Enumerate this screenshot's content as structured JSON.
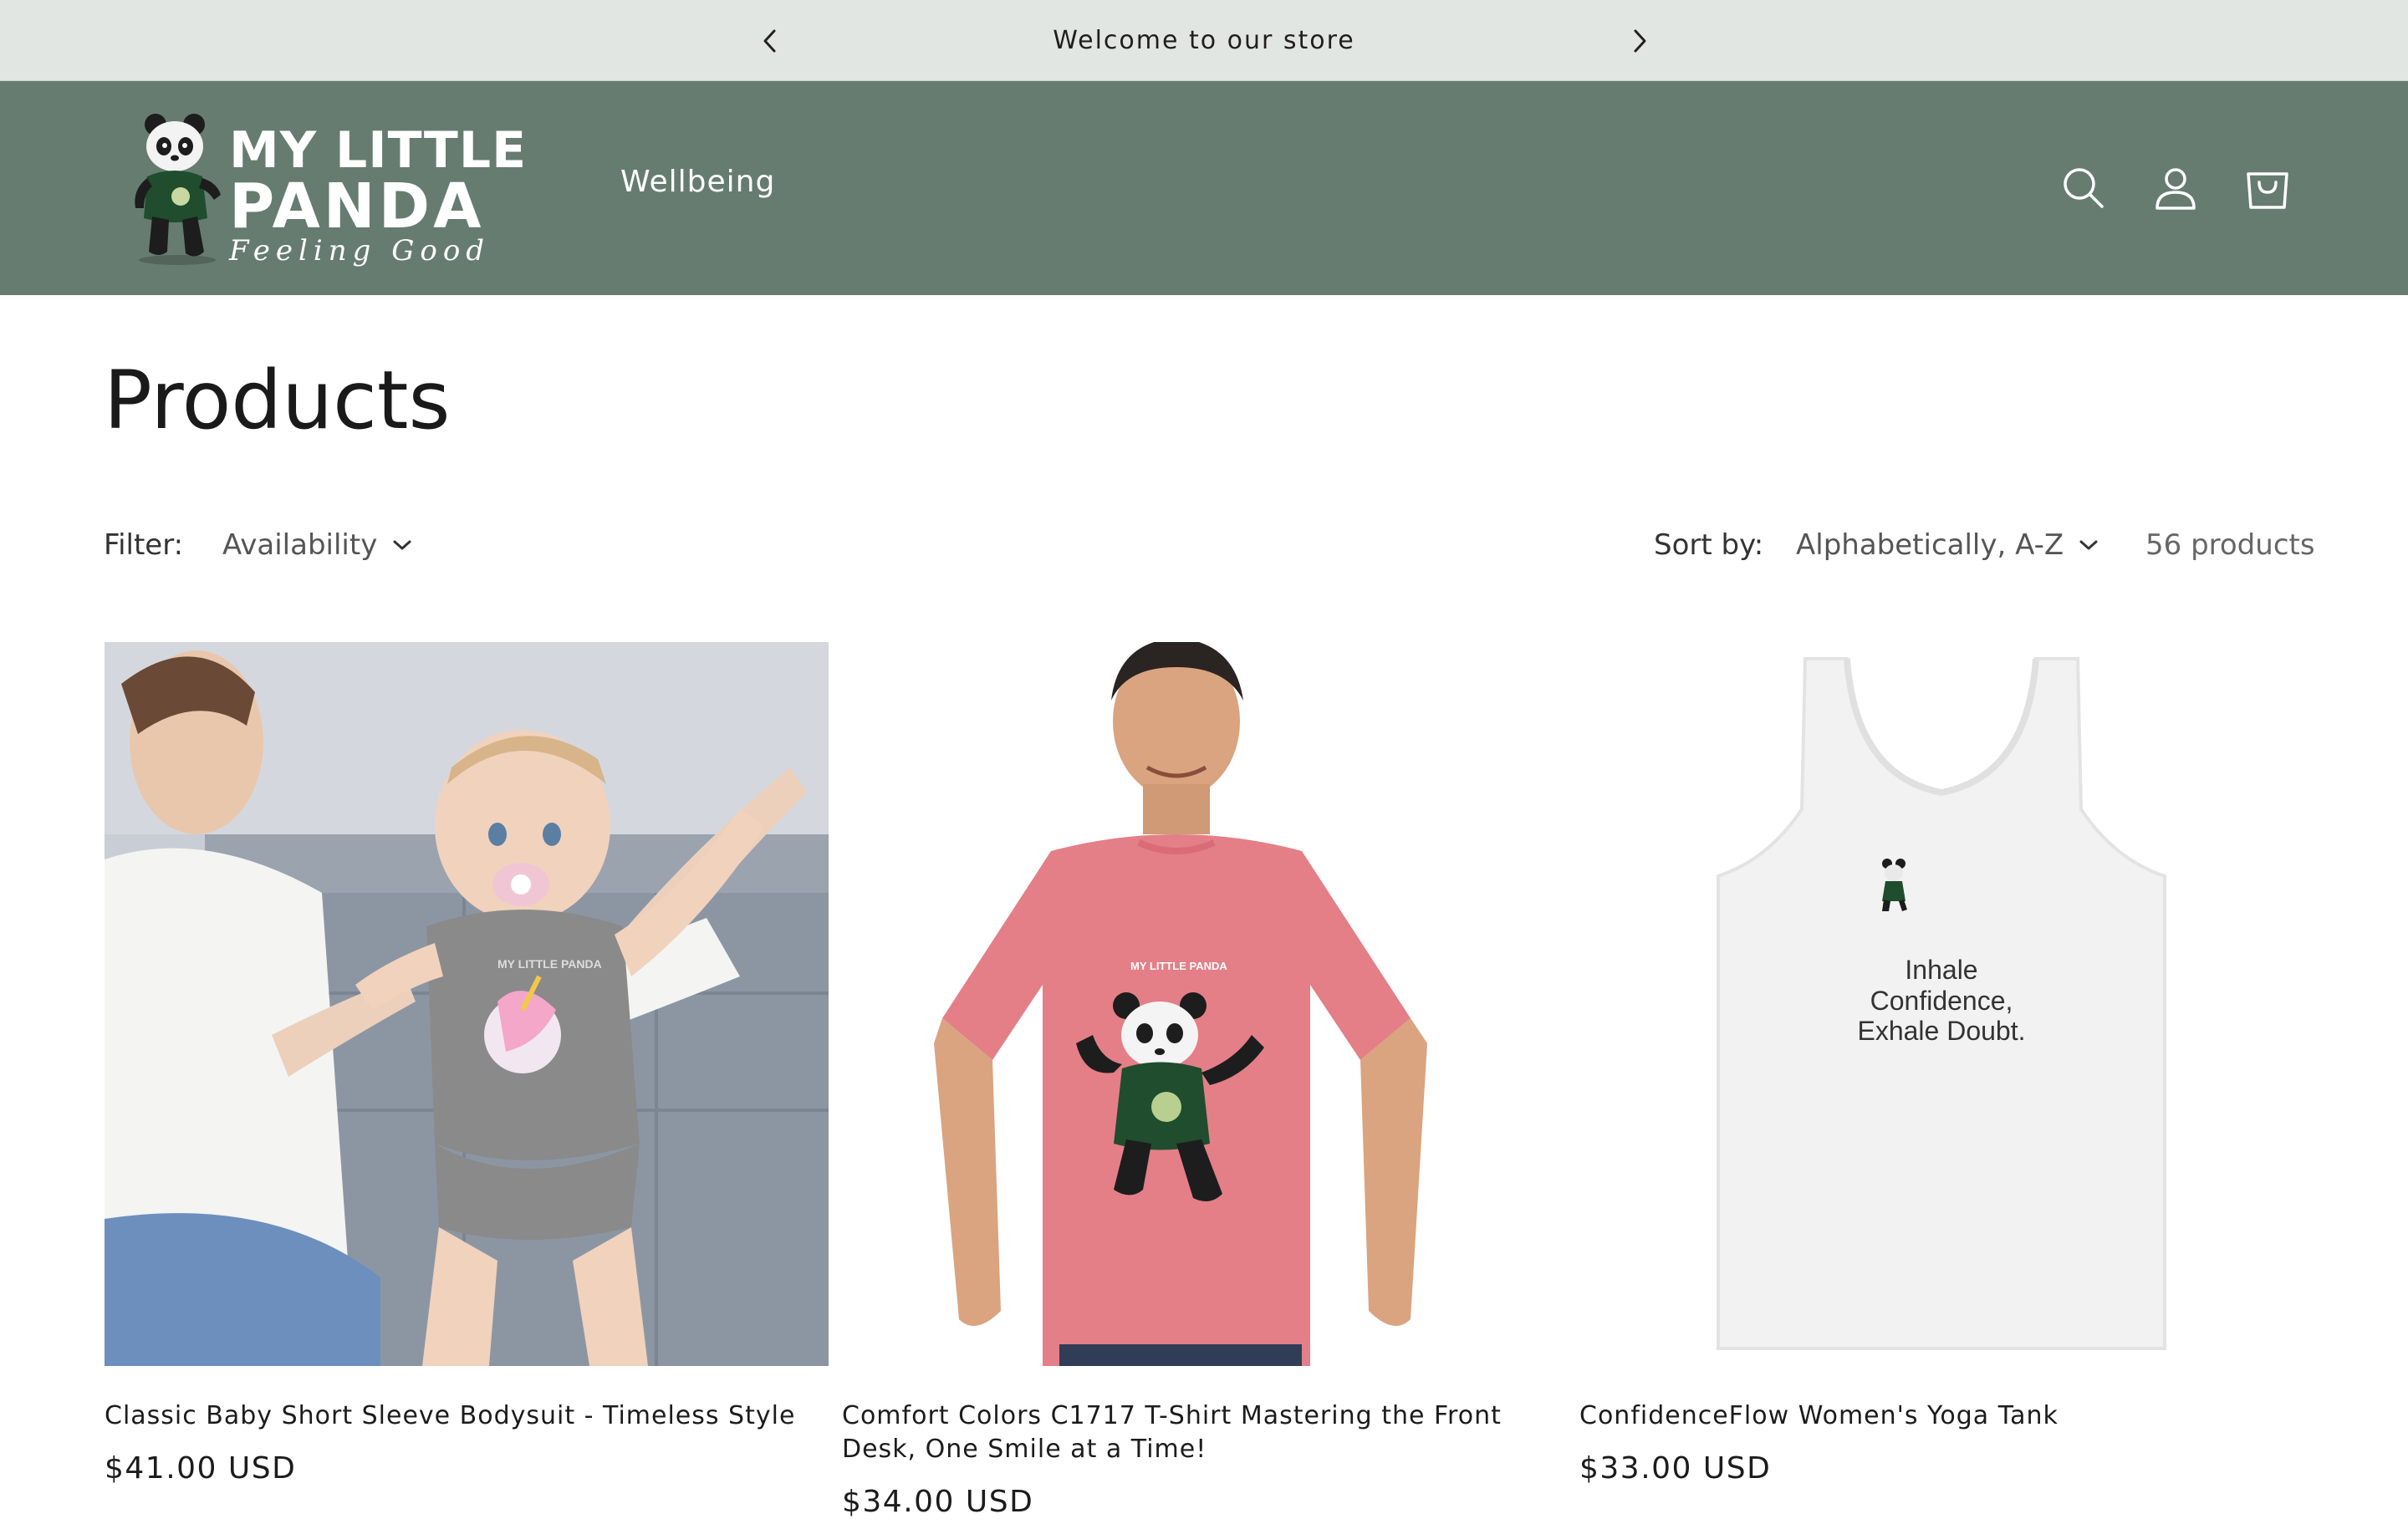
{
  "announcement": {
    "message": "Welcome to our store",
    "prev_icon": "chevron-left-icon",
    "next_icon": "chevron-right-icon"
  },
  "header": {
    "logo": {
      "line1": "MY LITTLE",
      "line2": "PANDA",
      "line3": "Feeling Good"
    },
    "nav": [
      {
        "label": "Wellbeing"
      }
    ],
    "icons": [
      "search-icon",
      "account-icon",
      "cart-icon"
    ],
    "background": "#667c70"
  },
  "page": {
    "title": "Products"
  },
  "toolbar": {
    "filter_label": "Filter:",
    "availability_label": "Availability",
    "sort_label": "Sort by:",
    "sort_value": "Alphabetically, A-Z",
    "product_count": "56 products"
  },
  "products": [
    {
      "title": "Classic Baby Short Sleeve Bodysuit - Timeless Style",
      "price": "$41.00 USD",
      "print_text": "MY LITTLE PANDA"
    },
    {
      "title": "Comfort Colors C1717 T-Shirt Mastering the Front Desk, One Smile at a Time!",
      "price": "$34.00 USD",
      "print_text": "MY LITTLE PANDA",
      "shirt_color": "#e47f87"
    },
    {
      "title": "ConfidenceFlow Women's Yoga Tank",
      "price": "$33.00 USD",
      "print_line1": "Inhale",
      "print_line2": "Confidence,",
      "print_line3": "Exhale Doubt."
    }
  ]
}
